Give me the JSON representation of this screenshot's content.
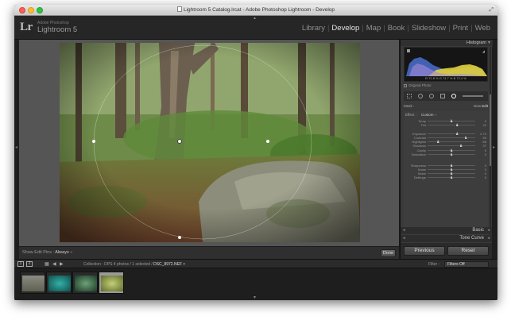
{
  "window": {
    "title": "Lightroom 5 Catalog.lrcat - Adobe Photoshop Lightroom - Develop"
  },
  "brand": {
    "logo": "Lr",
    "subtitle": "Adobe Photoshop",
    "name": "Lightroom 5"
  },
  "modules": [
    "Library",
    "Develop",
    "Map",
    "Book",
    "Slideshow",
    "Print",
    "Web"
  ],
  "active_module": "Develop",
  "toolbar": {
    "show_edit_pins_label": "Show Edit Pins :",
    "show_edit_pins_value": "Always",
    "done_label": "Done"
  },
  "right_panel": {
    "histogram_title": "Histogram",
    "exif": {
      "r": "R  72.8",
      "g": "G  74.7",
      "b": "B  72.4",
      "percent": "%"
    },
    "original_photo_label": "Original Photo",
    "mask_label": "Mask :",
    "mask_new": "New",
    "mask_edit": "Edit",
    "effect_label": "Effect :",
    "effect_value": "Custom",
    "sliders": [
      {
        "label": "Temp",
        "value": "0",
        "pos": 0.5
      },
      {
        "label": "Tint",
        "value": "22",
        "pos": 0.62
      },
      {
        "label": "Exposure",
        "value": "0.73",
        "pos": 0.62
      },
      {
        "label": "Contrast",
        "value": "60",
        "pos": 0.8
      },
      {
        "label": "Highlights",
        "value": "-58",
        "pos": 0.22
      },
      {
        "label": "Shadows",
        "value": "37",
        "pos": 0.7
      },
      {
        "label": "Clarity",
        "value": "0",
        "pos": 0.5
      },
      {
        "label": "Saturation",
        "value": "0",
        "pos": 0.5
      },
      {
        "label": "Sharpness",
        "value": "0",
        "pos": 0.5
      },
      {
        "label": "Noise",
        "value": "0",
        "pos": 0.5
      },
      {
        "label": "Moiré",
        "value": "0",
        "pos": 0.5
      },
      {
        "label": "Defringe",
        "value": "0",
        "pos": 0.5
      }
    ],
    "color_label": "Color",
    "feather_label": "Feather",
    "feather_value": "48",
    "invert_mask_label": "Invert Mask",
    "reset_label": "Reset",
    "close_label": "Close",
    "basic_label": "Basic",
    "tone_curve_label": "Tone Curve",
    "previous_label": "Previous",
    "reset_button_label": "Reset"
  },
  "filmstrip_bar": {
    "page1": "1",
    "page2": "2",
    "collection_label": "Collection : DPS",
    "count_label": "4 photos / 1 selected /",
    "selected_file": "DSC_8972.NEF",
    "filter_label": "Filter :",
    "filter_value": "Filters Off"
  },
  "filmstrip": [
    {
      "name": "thumb-1",
      "color": "#7b7b70",
      "selected": false
    },
    {
      "name": "thumb-2",
      "color": "#1f8c88",
      "selected": false
    },
    {
      "name": "thumb-3",
      "color": "#3c6e4c",
      "selected": false
    },
    {
      "name": "thumb-4",
      "color": "#8a9c4d",
      "selected": true
    }
  ],
  "colors": {
    "accent": "#e3e3e3",
    "panel": "#3a3a3a",
    "canvas": "#555555"
  }
}
